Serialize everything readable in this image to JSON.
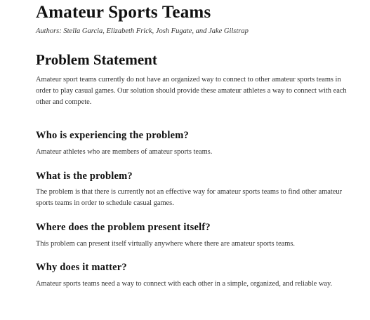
{
  "document": {
    "title": "Amateur Sports Teams",
    "authors": "Authors: Stella Garcia, Elizabeth Frick, Josh Fugate, and Jake Gilstrap",
    "section_heading": "Problem Statement",
    "intro": "Amateur sport teams currently do not have an organized way to connect to other amateur sports teams in order to play casual games. Our solution should provide these amateur athletes a way to connect with each other and compete.",
    "questions": [
      {
        "heading": "Who is experiencing the problem?",
        "answer": "Amateur athletes who are members of amateur sports teams."
      },
      {
        "heading": "What is the problem?",
        "answer": "The problem is that there is currently not an effective way for amateur sports teams to find other amateur sports teams in order to schedule casual games."
      },
      {
        "heading": "Where does the problem present itself?",
        "answer": "This problem can present itself virtually anywhere where there are amateur sports teams."
      },
      {
        "heading": "Why does it matter?",
        "answer": "Amateur sports teams need a way to connect with each other in a simple, organized, and reliable way."
      }
    ]
  }
}
